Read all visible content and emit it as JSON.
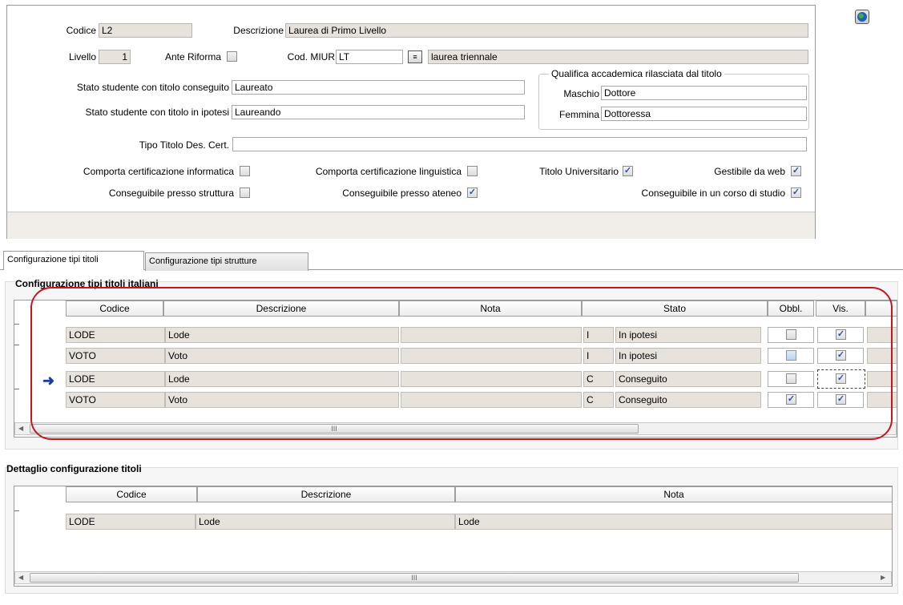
{
  "form": {
    "codice_label": "Codice",
    "codice_value": "L2",
    "descrizione_label": "Descrizione",
    "descrizione_value": "Laurea di Primo Livello",
    "livello_label": "Livello",
    "livello_value": "1",
    "ante_riforma_label": "Ante Riforma",
    "ante_riforma_checked": false,
    "cod_miur_label": "Cod. MIUR",
    "cod_miur_value": "LT",
    "cod_miur_desc": "laurea triennale",
    "stato_conseguito_label": "Stato studente con titolo conseguito",
    "stato_conseguito_value": "Laureato",
    "stato_ipotesi_label": "Stato studente con titolo in ipotesi",
    "stato_ipotesi_value": "Laureando",
    "qualifica_title": "Qualifica accademica rilasciata dal titolo",
    "maschio_label": "Maschio",
    "maschio_value": "Dottore",
    "femmina_label": "Femmina",
    "femmina_value": "Dottoressa",
    "tipo_titolo_label": "Tipo Titolo Des. Cert.",
    "tipo_titolo_value": "",
    "cb_cert_informatica_label": "Comporta certificazione informatica",
    "cb_cert_informatica": false,
    "cb_cert_linguistica_label": "Comporta certificazione linguistica",
    "cb_cert_linguistica": false,
    "cb_titolo_universitario_label": "Titolo Universitario",
    "cb_titolo_universitario": true,
    "cb_gestibile_web_label": "Gestibile da web",
    "cb_gestibile_web": true,
    "cb_presso_struttura_label": "Conseguibile presso struttura",
    "cb_presso_struttura": false,
    "cb_presso_ateneo_label": "Conseguibile presso ateneo",
    "cb_presso_ateneo": true,
    "cb_corso_studio_label": "Conseguibile in un corso di studio",
    "cb_corso_studio": true
  },
  "tabs": [
    {
      "label": "Configurazione tipi titoli",
      "active": true
    },
    {
      "label": "Configurazione tipi strutture",
      "active": false
    }
  ],
  "config_grid": {
    "section_title": "Configurazione tipi titoli italiani",
    "columns": [
      "Codice",
      "Descrizione",
      "Nota",
      "Stato",
      "Obbl.",
      "Vis."
    ],
    "rows": [
      {
        "codice": "LODE",
        "descrizione": "Lode",
        "nota": "",
        "stato_code": "I",
        "stato": "In ipotesi",
        "obbl": false,
        "vis": true
      },
      {
        "codice": "VOTO",
        "descrizione": "Voto",
        "nota": "",
        "stato_code": "I",
        "stato": "In ipotesi",
        "obbl": false,
        "vis": true
      },
      {
        "codice": "LODE",
        "descrizione": "Lode",
        "nota": "",
        "stato_code": "C",
        "stato": "Conseguito",
        "obbl": false,
        "vis": true
      },
      {
        "codice": "VOTO",
        "descrizione": "Voto",
        "nota": "",
        "stato_code": "C",
        "stato": "Conseguito",
        "obbl": true,
        "vis": true
      }
    ],
    "scroll_thumb": "III"
  },
  "detail_grid": {
    "section_title": "Dettaglio configurazione titoli",
    "columns": [
      "Codice",
      "Descrizione",
      "Nota"
    ],
    "rows": [
      {
        "codice": "LODE",
        "descrizione": "Lode",
        "nota": "Lode"
      }
    ],
    "scroll_thumb": "III"
  },
  "icons": {
    "globe": "globe-icon",
    "lookup": "lookup-icon",
    "row_pointer": "arrow-right-icon"
  },
  "colors": {
    "field_bg": "#e7e2dc",
    "highlight": "#c8141e",
    "pointer": "#1b3f9c"
  }
}
